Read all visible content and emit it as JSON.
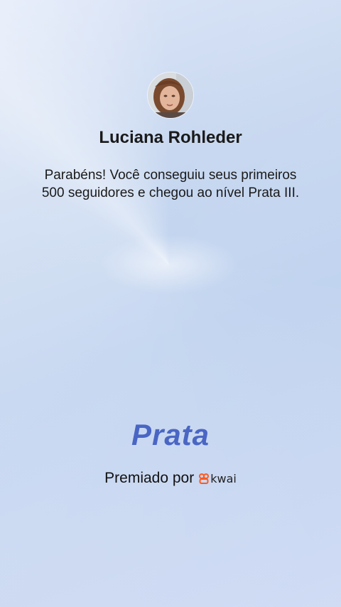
{
  "profile": {
    "name": "Luciana Rohleder"
  },
  "message": {
    "text": "Parabéns! Você conseguiu seus primeiros 500 seguidores e chegou ao nível Prata III."
  },
  "level": {
    "title": "Prata"
  },
  "awarded": {
    "label": "Premiado por",
    "brand": "kwai",
    "brand_icon": "kwai-logo-icon",
    "brand_color": "#ff5a1f"
  },
  "colors": {
    "level_color": "#4a66c4"
  }
}
